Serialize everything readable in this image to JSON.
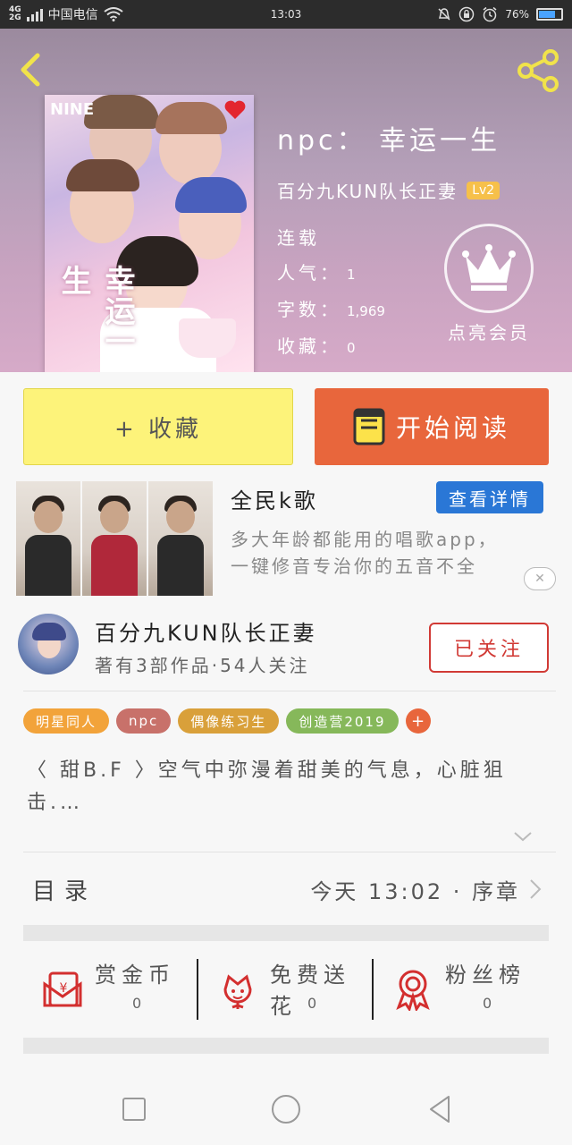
{
  "status_bar": {
    "network": "4G",
    "network2": "2G",
    "carrier": "中国电信",
    "time": "13:03",
    "battery": "76%"
  },
  "hero": {
    "title": "npc： 幸运一生",
    "author": "百分九KUN队长正妻",
    "level": "Lv2",
    "status": "连载",
    "popularity_label": "人气：",
    "popularity_value": "1",
    "wordcount_label": "字数：",
    "wordcount_value": "1,969",
    "favorites_label": "收藏：",
    "favorites_value": "0",
    "vip_label": "点亮会员",
    "cover_text_top": "NINE",
    "cover_text_side": "幸运一生"
  },
  "buttons": {
    "favorite": "+ 收藏",
    "read": "开始阅读"
  },
  "ad": {
    "title": "全民k歌",
    "detail": "查看详情",
    "desc_line1": "多大年龄都能用的唱歌app，",
    "desc_line2": "一键修音专治你的五音不全",
    "close": "✕"
  },
  "author_row": {
    "name": "百分九KUN队长正妻",
    "sub": "著有3部作品·54人关注",
    "follow": "已关注"
  },
  "tags": [
    {
      "label": "明星同人",
      "color": "#f2a33a"
    },
    {
      "label": "npc",
      "color": "#c8716a"
    },
    {
      "label": "偶像练习生",
      "color": "#d9a03a"
    },
    {
      "label": "创造营2019",
      "color": "#86b85a"
    },
    {
      "label": "+",
      "color": "#e8663c"
    }
  ],
  "synopsis": "〈 甜B.F 〉空气中弥漫着甜美的气息，心脏狙击.…",
  "catalog": {
    "title": "目录",
    "latest": "今天 13:02 · 序章"
  },
  "actions": [
    {
      "label": "赏金币",
      "count": "0",
      "icon": "red-envelope-icon"
    },
    {
      "label": "免费送花",
      "count": "0",
      "icon": "flower-icon"
    },
    {
      "label": "粉丝榜",
      "count": "0",
      "icon": "medal-icon"
    }
  ],
  "colors": {
    "accent_orange": "#e8663c",
    "favorite_yellow": "#fdf37a",
    "follow_red": "#d13a35",
    "detail_blue": "#2a77d6"
  }
}
